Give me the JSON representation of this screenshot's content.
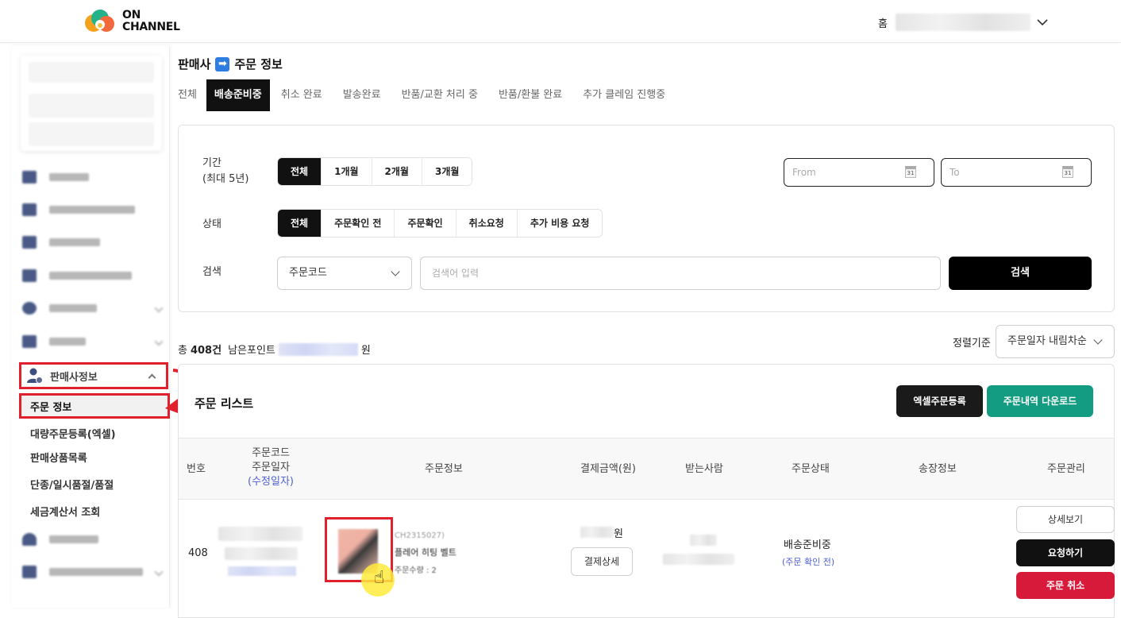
{
  "brand": {
    "line1": "ON",
    "line2": "CHANNEL"
  },
  "header": {
    "home_label": "홈"
  },
  "sidebar": {
    "seller_info_label": "판매사정보",
    "active_item": "주문 정보",
    "sub_items": [
      "대량주문등록(엑셀)",
      "판매상품목록",
      "단종/일시품절/품절",
      "세금계산서 조회"
    ]
  },
  "breadcrumb": {
    "part1": "판매사",
    "arrow": "➡",
    "part2": "주문 정보"
  },
  "tabs": [
    "전체",
    "배송준비중",
    "취소 완료",
    "발송완료",
    "반품/교환 처리 중",
    "반품/환불 완료",
    "추가 클레임 진행중"
  ],
  "filters": {
    "period_label_1": "기간",
    "period_label_2": "(최대 5년)",
    "period_options": [
      "전체",
      "1개월",
      "2개월",
      "3개월"
    ],
    "from_placeholder": "From",
    "to_placeholder": "To",
    "calendar_day": "31",
    "status_label": "상태",
    "status_options": [
      "전체",
      "주문확인 전",
      "주문확인",
      "취소요청",
      "추가 비용 요청"
    ],
    "search_label": "검색",
    "search_type": "주문코드",
    "search_placeholder": "검색어 입력",
    "search_button": "검색"
  },
  "summary": {
    "total_prefix": "총",
    "total_count": "408건",
    "points_label": "남은포인트",
    "points_unit": "원"
  },
  "sort": {
    "label": "정렬기준",
    "value": "주문일자 내림차순"
  },
  "list": {
    "title": "주문 리스트",
    "excel_button": "엑셀주문등록",
    "download_button": "주문내역 다운로드",
    "headers": {
      "no": "번호",
      "code_1": "주문코드",
      "code_2": "주문일자",
      "code_3": "(수정일자)",
      "info": "주문정보",
      "amount": "결제금액(원)",
      "receiver": "받는사람",
      "status": "주문상태",
      "invoice": "송장정보",
      "manage": "주문관리"
    },
    "row": {
      "no": "408",
      "product_code": "CH2315027)",
      "product_name": "플레어 히팅 벨트",
      "product_qty": "주문수량 : 2",
      "amount_unit": "원",
      "pay_detail_button": "결제상세",
      "status": "배송준비중",
      "status_sub": "(주문 확인 전)",
      "detail_button": "상세보기",
      "request_button": "요청하기",
      "cancel_button": "주문 취소"
    }
  }
}
